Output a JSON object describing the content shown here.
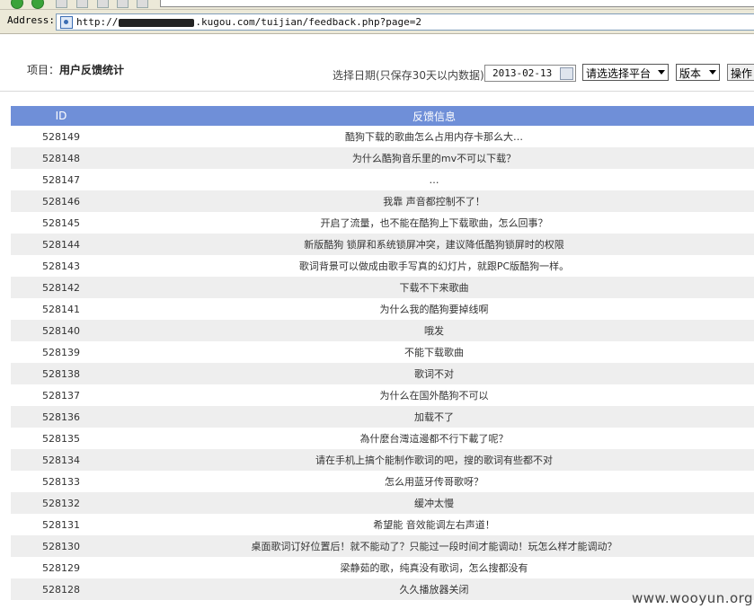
{
  "browser": {
    "address_label": "Address:",
    "url_prefix": "http://",
    "url_suffix": ".kugou.com/tuijian/feedback.php?page=2"
  },
  "header": {
    "project_prefix": "项目：",
    "project_name": "用户反馈统计",
    "date_label": "选择日期(只保存30天以内数据)",
    "date_value": "2013-02-13",
    "platform_select": "请选选择平台",
    "version_select": "版本",
    "operate_button": "操作"
  },
  "table": {
    "headers": [
      "ID",
      "反馈信息"
    ],
    "rows": [
      {
        "id": "528149",
        "msg": "酷狗下载的歌曲怎么占用内存卡那么大…"
      },
      {
        "id": "528148",
        "msg": "为什么酷狗音乐里的mv不可以下载？"
      },
      {
        "id": "528147",
        "msg": "…"
      },
      {
        "id": "528146",
        "msg": "我靠 声音都控制不了！"
      },
      {
        "id": "528145",
        "msg": "开启了流量，也不能在酷狗上下载歌曲，怎么回事？"
      },
      {
        "id": "528144",
        "msg": "新版酷狗 锁屏和系统锁屏冲突，建议降低酷狗锁屏时的权限"
      },
      {
        "id": "528143",
        "msg": "歌词背景可以做成由歌手写真的幻灯片，就跟PC版酷狗一样。"
      },
      {
        "id": "528142",
        "msg": "下载不下来歌曲"
      },
      {
        "id": "528141",
        "msg": "为什么我的酷狗要掉线啊"
      },
      {
        "id": "528140",
        "msg": "哦发"
      },
      {
        "id": "528139",
        "msg": "不能下载歌曲"
      },
      {
        "id": "528138",
        "msg": "歌词不对"
      },
      {
        "id": "528137",
        "msg": "为什么在国外酷狗不可以"
      },
      {
        "id": "528136",
        "msg": "加载不了"
      },
      {
        "id": "528135",
        "msg": "為什麼台灣這邊都不行下載了呢？"
      },
      {
        "id": "528134",
        "msg": "请在手机上搞个能制作歌词的吧，搜的歌词有些都不对"
      },
      {
        "id": "528133",
        "msg": "怎么用蓝牙传哥歌呀？"
      },
      {
        "id": "528132",
        "msg": "缓冲太慢"
      },
      {
        "id": "528131",
        "msg": "希望能 音效能调左右声道！"
      },
      {
        "id": "528130",
        "msg": "桌面歌词订好位置后！就不能动了？只能过一段时间才能调动！玩怎么样才能调动？"
      },
      {
        "id": "528129",
        "msg": "梁静茹的歌，纯真没有歌词，怎么搜都没有"
      },
      {
        "id": "528128",
        "msg": "久久播放器关闭"
      }
    ]
  },
  "watermark": "www.wooyun.org"
}
